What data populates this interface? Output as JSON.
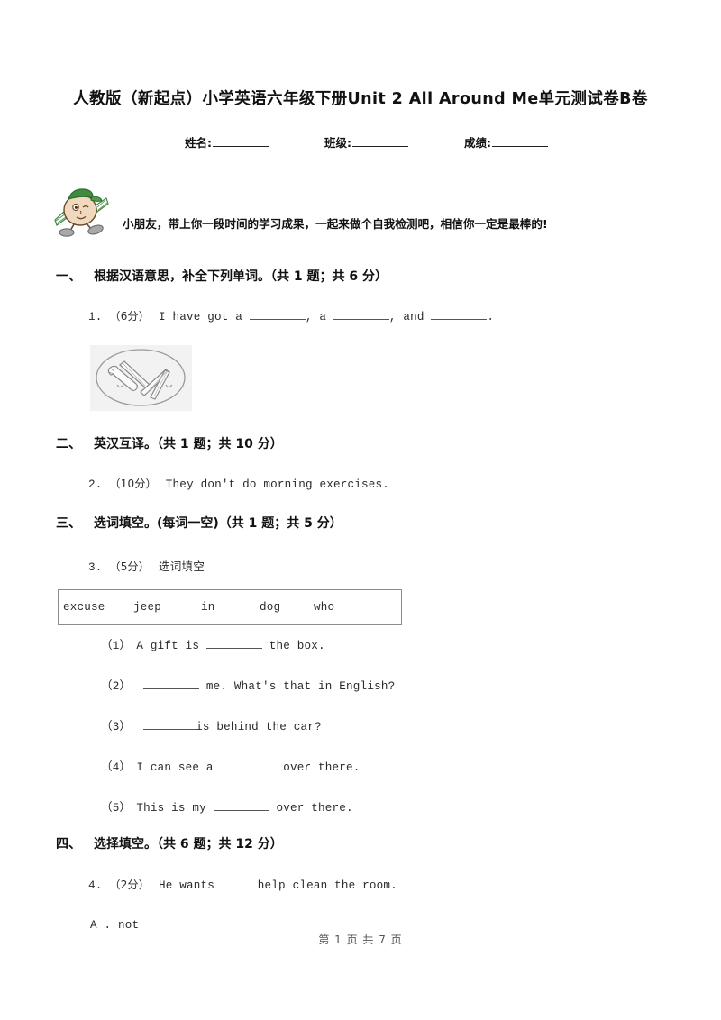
{
  "document": {
    "title": "人教版（新起点）小学英语六年级下册Unit 2 All Around Me单元测试卷B卷",
    "footer": "第 1 页 共 7 页"
  },
  "student_info": {
    "name_label": "姓名:",
    "class_label": "班级:",
    "score_label": "成绩:"
  },
  "intro": {
    "text": "小朋友，带上你一段时间的学习成果，一起来做个自我检测吧，相信你一定是最棒的!",
    "mascot_icon": "cartoon-boy-with-green-cap-icon"
  },
  "sections": [
    {
      "num": "一、",
      "title": "根据汉语意思，补全下列单词。（共 1 题；共 6 分）"
    },
    {
      "num": "二、",
      "title": "英汉互译。（共 1 题；共 10 分）"
    },
    {
      "num": "三、",
      "title": "选词填空。(每词一空)（共 1 题；共 5 分）"
    },
    {
      "num": "四、",
      "title": "选择填空。（共 6 题；共 12 分）"
    }
  ],
  "questions": {
    "q1": {
      "num": "1.",
      "score": "（6分）",
      "part_a": "I have got a",
      "part_b": ", a",
      "part_c": ", and",
      "part_d": ".",
      "picture_alt": "tools-line-drawing"
    },
    "q2": {
      "num": "2.",
      "score": "（10分）",
      "text": "They don't do morning exercises."
    },
    "q3": {
      "num": "3.",
      "score": "（5分）",
      "text": "选词填空",
      "wordbank": [
        "excuse",
        "jeep",
        "in",
        "dog",
        "who"
      ],
      "subquestions": [
        {
          "idx": "（1）",
          "before": "A gift is",
          "after": "the box."
        },
        {
          "idx": "（2）",
          "before": "",
          "after": "me. What's that in English?"
        },
        {
          "idx": "（3）",
          "before": "",
          "after": "is behind the car?"
        },
        {
          "idx": "（4）",
          "before": "I can see a",
          "after": "over there."
        },
        {
          "idx": "（5）",
          "before": "This is my",
          "after": "over there."
        }
      ]
    },
    "q4": {
      "num": "4.",
      "score": "（2分）",
      "before": "He wants",
      "after": "help clean the room.",
      "options": [
        {
          "label": "A . not"
        }
      ]
    }
  }
}
